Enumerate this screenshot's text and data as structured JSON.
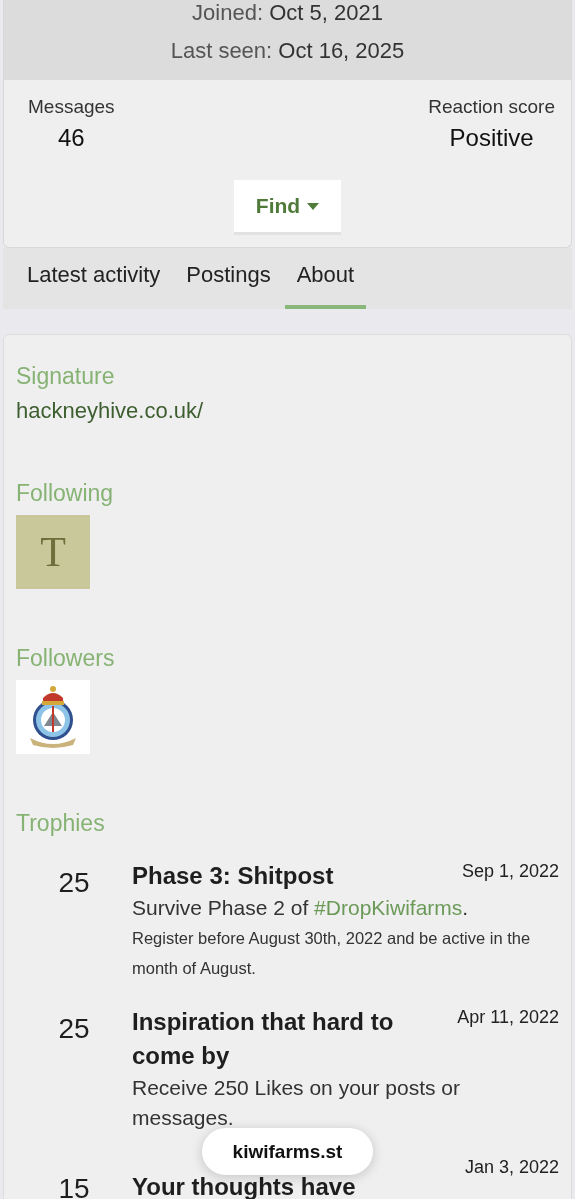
{
  "profile": {
    "joined_label": "Joined:",
    "joined": "Oct 5, 2021",
    "last_seen_label": "Last seen:",
    "last_seen": "Oct 16, 2025"
  },
  "stats": [
    {
      "label": "Messages",
      "value": "46"
    },
    {
      "label": "Reaction score",
      "value": "Positive"
    }
  ],
  "find_button": {
    "label": "Find"
  },
  "tabs": [
    {
      "label": "Latest activity",
      "selected": false
    },
    {
      "label": "Postings",
      "selected": false
    },
    {
      "label": "About",
      "selected": true
    }
  ],
  "about": {
    "signature": {
      "heading": "Signature",
      "link": "hackneyhive.co.uk/"
    },
    "following": {
      "heading": "Following",
      "users": [
        {
          "kind": "letter",
          "letter": "T"
        }
      ]
    },
    "followers": {
      "heading": "Followers"
    },
    "trophies": {
      "heading": "Trophies",
      "items": [
        {
          "points": "25",
          "title": "Phase 3: Shitpost",
          "date": "Sep 1, 2022",
          "description": [
            {
              "kind": "text",
              "text": "Survive Phase 2 of "
            },
            {
              "kind": "link",
              "text": "#DropKiwifarms"
            },
            {
              "kind": "text",
              "text": "."
            }
          ],
          "note": "Register before August 30th, 2022 and be active in the month of August."
        },
        {
          "points": "25",
          "title": "Inspiration that hard to come by",
          "date": "Apr 11, 2022",
          "description": [
            {
              "kind": "text",
              "text": "Receive 250 Likes on your posts or messages."
            }
          ]
        },
        {
          "points": "15",
          "title": "Your thoughts have",
          "date": "Jan 3, 2022"
        }
      ]
    }
  },
  "address_pill": {
    "domain": "kiwifarms.st"
  }
}
